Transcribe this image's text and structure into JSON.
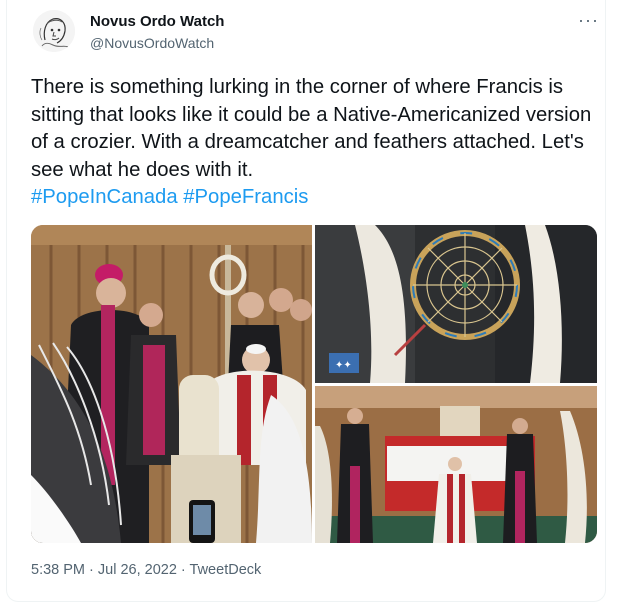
{
  "author": {
    "name": "Novus Ordo Watch",
    "handle": "@NovusOrdoWatch",
    "avatar_icon": "sketch-portrait-avatar"
  },
  "more_icon": "more-dots-icon",
  "tweet": {
    "text": "There is something lurking in the corner of where Francis is sitting that looks like it could be a Native-Americanized version of a crozier. With a dreamcatcher and feathers attached. Let's see what he does with it. ",
    "hashtags": [
      "#PopeInCanada",
      "#PopeFrancis"
    ]
  },
  "media": {
    "images": [
      {
        "description_icon": "photo-church-interior"
      },
      {
        "description_icon": "photo-dreamcatcher-closeup"
      },
      {
        "description_icon": "photo-altar-wide"
      }
    ]
  },
  "footer": {
    "time": "5:38 PM",
    "separator": " · ",
    "date": "Jul 26, 2022",
    "source": "TweetDeck"
  },
  "colors": {
    "link": "#1d9bf0",
    "text": "#0f1419",
    "secondary": "#536471"
  }
}
